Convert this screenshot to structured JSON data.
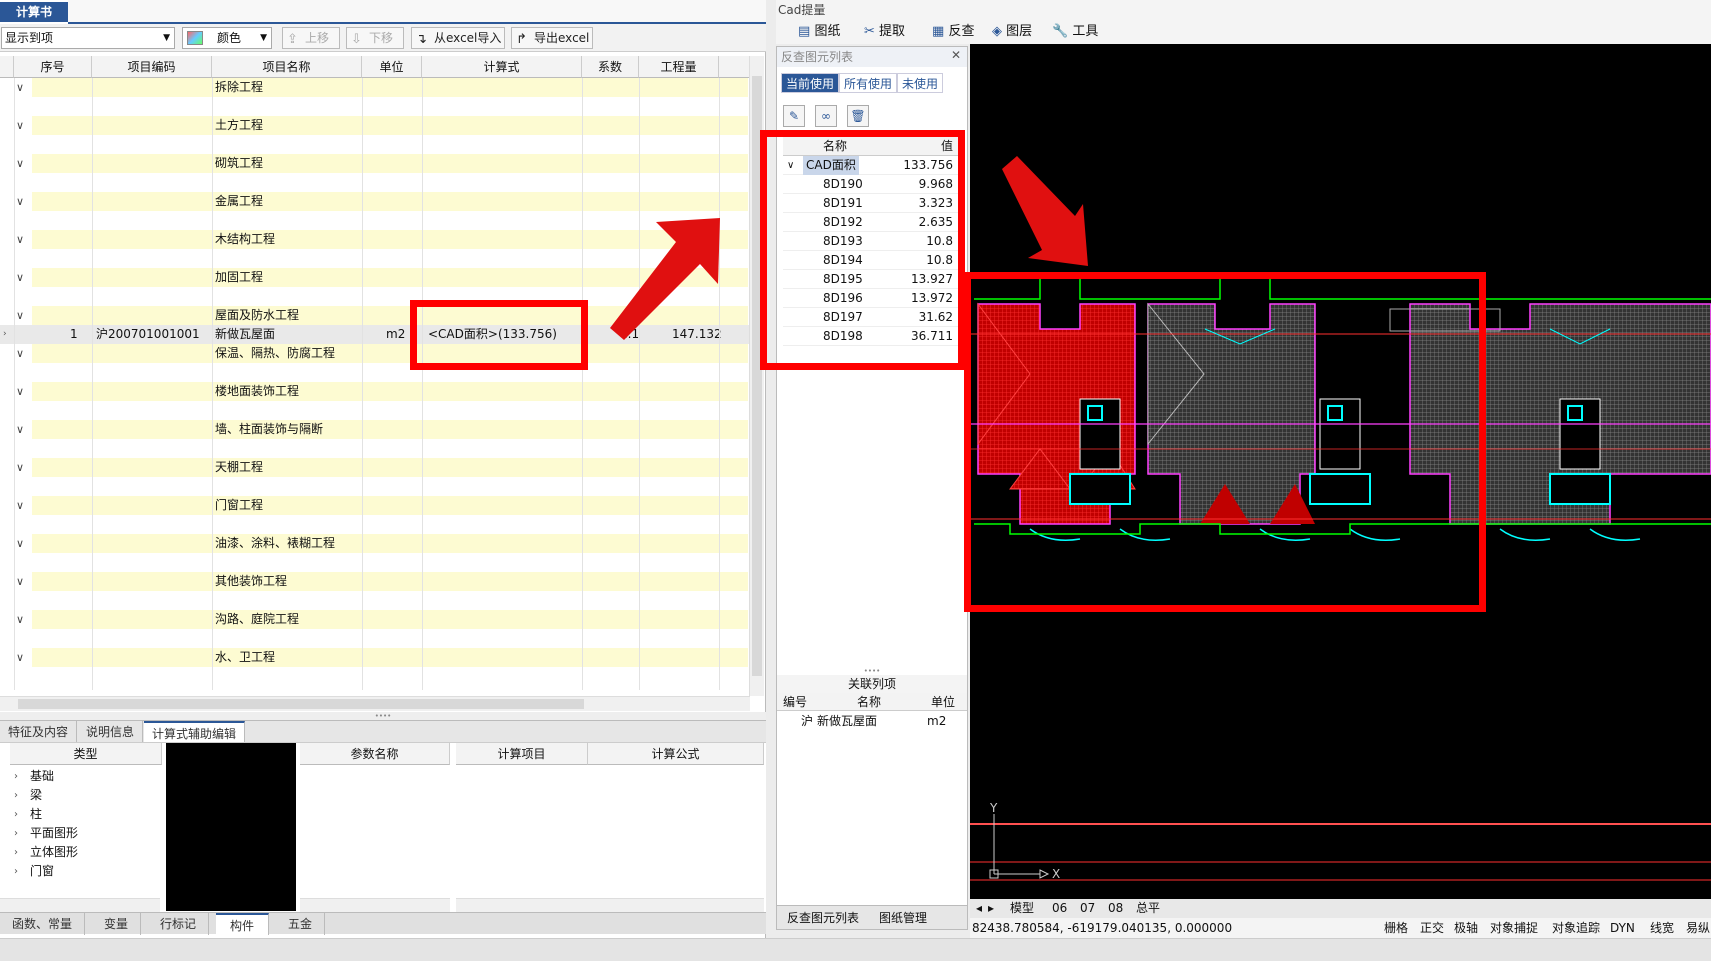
{
  "left": {
    "tab_title": "计算书",
    "combo_display": "显示到项",
    "color_label": "颜色",
    "btn_up": "上移",
    "btn_down": "下移",
    "btn_import": "从excel导入",
    "btn_export": "导出excel",
    "columns": [
      "序号",
      "项目编码",
      "项目名称",
      "单位",
      "计算式",
      "系数",
      "工程量"
    ],
    "categories": [
      "拆除工程",
      "土方工程",
      "砌筑工程",
      "金属工程",
      "木结构工程",
      "加固工程",
      "屋面及防水工程",
      "保温、隔热、防腐工程",
      "楼地面装饰工程",
      "墙、柱面装饰与隔断",
      "天棚工程",
      "门窗工程",
      "油漆、涂料、裱糊工程",
      "其他装饰工程",
      "沟路、庭院工程",
      "水、卫工程"
    ],
    "detail": {
      "no": "1",
      "code": "沪200701001001",
      "name": "新做瓦屋面",
      "unit": "m2",
      "formula": "<CAD面积>(133.756)",
      "coef": "1.1",
      "qty": "147.132"
    },
    "bottom_tabs": [
      "特征及内容",
      "说明信息",
      "计算式辅助编辑"
    ],
    "type_header": "类型",
    "types": [
      "基础",
      "梁",
      "柱",
      "平面图形",
      "立体图形",
      "门窗"
    ],
    "param_header": "参数名称",
    "calc_item_header": "计算项目",
    "calc_formula_header": "计算公式",
    "foot_tabs": [
      "函数、常量",
      "变量",
      "行标记",
      "构件",
      "五金"
    ]
  },
  "right": {
    "title": "Cad提量",
    "tools": [
      "图纸",
      "提取",
      "反查",
      "图层",
      "工具"
    ],
    "panel_title": "反查图元列表",
    "filter_tabs": [
      "当前使用",
      "所有使用",
      "未使用"
    ],
    "pcols": [
      "名称",
      "值"
    ],
    "root": {
      "name": "CAD面积",
      "value": "133.756"
    },
    "items": [
      {
        "name": "8D190",
        "value": "9.968"
      },
      {
        "name": "8D191",
        "value": "3.323"
      },
      {
        "name": "8D192",
        "value": "2.635"
      },
      {
        "name": "8D193",
        "value": "10.8"
      },
      {
        "name": "8D194",
        "value": "10.8"
      },
      {
        "name": "8D195",
        "value": "13.927"
      },
      {
        "name": "8D196",
        "value": "13.972"
      },
      {
        "name": "8D197",
        "value": "31.62"
      },
      {
        "name": "8D198",
        "value": "36.711"
      }
    ],
    "related_title": "关联列项",
    "rcols": [
      "编号",
      "名称",
      "单位"
    ],
    "related_row": {
      "code": "沪",
      "name": "新做瓦屋面",
      "unit": "m2"
    },
    "panel_tabs": [
      "反查图元列表",
      "图纸管理"
    ],
    "layout_tabs": [
      "模型",
      "06",
      "07",
      "08",
      "总平"
    ],
    "coords": "82438.780584,  -619179.040135,  0.000000",
    "status_items": [
      "栅格",
      "正交",
      "极轴",
      "对象捕捉",
      "对象追踪",
      "DYN",
      "线宽",
      "易纵"
    ],
    "axis_y": "Y",
    "axis_x": "X"
  }
}
